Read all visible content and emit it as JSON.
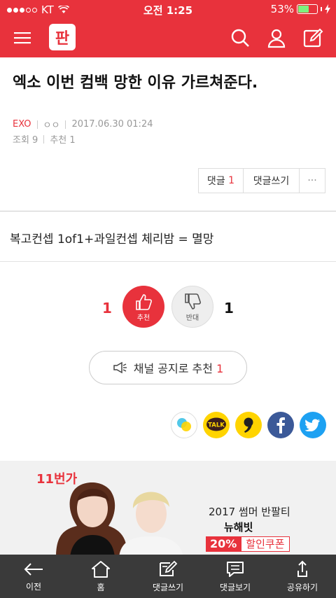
{
  "status_bar": {
    "carrier": "KT",
    "time": "오전 1:25",
    "battery": "53%",
    "battery_level": 0.53
  },
  "header": {
    "logo_text": "판"
  },
  "post": {
    "title": "엑소 이번 컴백 망한 이유 가르쳐준다.",
    "channel": "EXO",
    "author": "ㅇㅇ",
    "datetime": "2017.06.30 01:24",
    "views": "조회 9",
    "recommend_label": "추천",
    "recommend_count": "1",
    "body": "복고컨셉 1of1+과일컨셉 체리밤 = 멸망"
  },
  "actions": {
    "comments_label": "댓글",
    "comments_count": "1",
    "write_comment": "댓글쓰기",
    "more": "···"
  },
  "vote": {
    "up_count": "1",
    "up_label": "추천",
    "down_label": "반대",
    "down_count": "1"
  },
  "notice": {
    "label": "채널 공지로 추천",
    "count": "1"
  },
  "share": {
    "talk_label": "TALK"
  },
  "ad": {
    "brand": "11번가",
    "line1": "2017 썸머 반팔티",
    "line2": "뉴해빗",
    "percent": "20%",
    "coupon": "할인쿠폰"
  },
  "bottom_nav": [
    {
      "label": "이전",
      "icon": "back-arrow-icon"
    },
    {
      "label": "홈",
      "icon": "home-icon"
    },
    {
      "label": "댓글쓰기",
      "icon": "write-icon"
    },
    {
      "label": "댓글보기",
      "icon": "comment-icon"
    },
    {
      "label": "공유하기",
      "icon": "share-icon"
    }
  ]
}
